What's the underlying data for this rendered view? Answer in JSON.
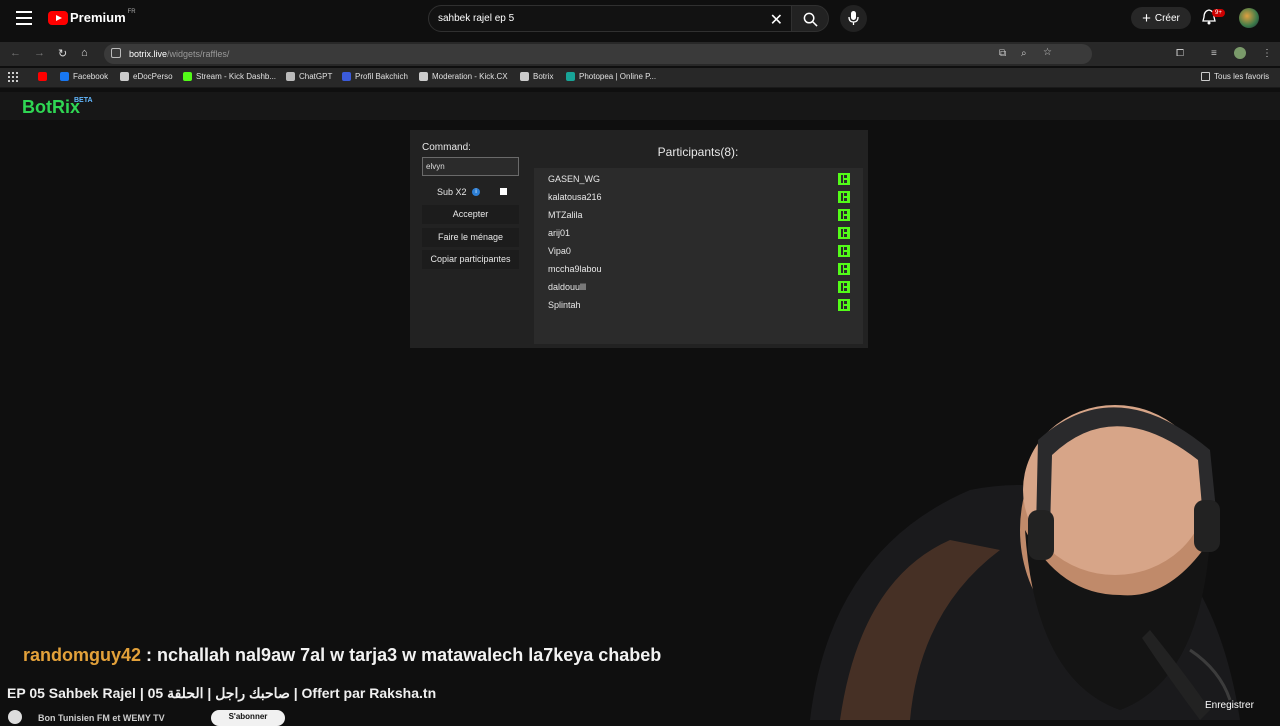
{
  "youtube": {
    "logo_text": "Premium",
    "region": "FR",
    "search_query": "sahbek rajel ep 5",
    "create_label": "Créer",
    "notif_badge": "9+"
  },
  "browser": {
    "url_host": "botrix.live",
    "url_path": "/widgets/raffles/",
    "bookmarks": [
      {
        "label": "",
        "icon": "youtube-icon",
        "color": "#ff0000"
      },
      {
        "label": "Facebook",
        "icon": "facebook-icon",
        "color": "#1877f2"
      },
      {
        "label": "eDocPerso",
        "icon": "edocperso-icon",
        "color": "#cccccc"
      },
      {
        "label": "Stream - Kick Dashb...",
        "icon": "kick-icon",
        "color": "#53fc18"
      },
      {
        "label": "ChatGPT",
        "icon": "chatgpt-icon",
        "color": "#bbbbbb"
      },
      {
        "label": "Profil Bakchich",
        "icon": "bakchich-icon",
        "color": "#3b5bdb"
      },
      {
        "label": "Moderation - Kick.CX",
        "icon": "moderation-icon",
        "color": "#cccccc"
      },
      {
        "label": "Botrix",
        "icon": "botrix-icon",
        "color": "#cccccc"
      },
      {
        "label": "Photopea | Online P...",
        "icon": "photopea-icon",
        "color": "#18a497"
      }
    ],
    "all_bookmarks_label": "Tous les favoris"
  },
  "botrix": {
    "logo": "BotRix",
    "beta": "BETA",
    "command_label": "Command:",
    "command_value": "elvyn",
    "sub_label": "Sub X2",
    "buttons": [
      "Accepter",
      "Faire le ménage",
      "Copiar participantes"
    ],
    "participants_title": "Participants(8):",
    "participants": [
      "GASEN_WG",
      "kalatousa216",
      "MTZalila",
      "arij01",
      "Vipa0",
      "mccha9labou",
      "daldouulll",
      "Splintah"
    ]
  },
  "overlay": {
    "chat_user": "randomguy42",
    "chat_message": " : nchallah nal9aw 7al w tarja3 w matawalech la7keya chabeb",
    "video_title": "EP 05 Sahbek Rajel | صاحبك راجل | الحلقة 05 | Offert par Raksha.tn",
    "channel_name": "Bon Tunisien FM et WEMY TV",
    "subscribe_label": "S'abonner",
    "save_label": "Enregistrer"
  }
}
